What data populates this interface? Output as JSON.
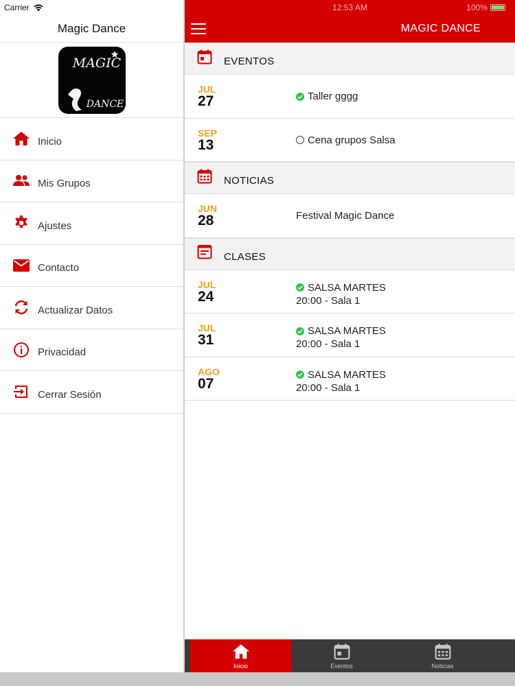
{
  "sidebar": {
    "status": {
      "carrier": "Carrier"
    },
    "title": "Magic Dance",
    "logo": {
      "top_text": "MAGIC",
      "bottom_text": "DANCE"
    },
    "items": [
      {
        "label": "Inicio",
        "icon": "home-icon"
      },
      {
        "label": "Mis Grupos",
        "icon": "groups-icon"
      },
      {
        "label": "Ajustes",
        "icon": "gear-icon"
      },
      {
        "label": "Contacto",
        "icon": "mail-icon"
      },
      {
        "label": "Actualizar Datos",
        "icon": "sync-icon"
      },
      {
        "label": "Privacidad",
        "icon": "info-icon"
      },
      {
        "label": "Cerrar Sesión",
        "icon": "logout-icon"
      }
    ]
  },
  "main": {
    "status": {
      "time": "12:53 AM",
      "battery": "100%"
    },
    "nav_title": "MAGIC DANCE",
    "sections": {
      "eventos": {
        "label": "EVENTOS",
        "rows": [
          {
            "month": "JUL",
            "day": "27",
            "title": "Taller gggg",
            "status": "confirmed"
          },
          {
            "month": "SEP",
            "day": "13",
            "title": "Cena grupos Salsa",
            "status": "pending"
          }
        ]
      },
      "noticias": {
        "label": "NOTICIAS",
        "rows": [
          {
            "month": "JUN",
            "day": "28",
            "title": "Festival Magic Dance"
          }
        ]
      },
      "clases": {
        "label": "CLASES",
        "rows": [
          {
            "month": "JUL",
            "day": "24",
            "title": "SALSA MARTES",
            "detail": "20:00 - Sala 1",
            "status": "confirmed"
          },
          {
            "month": "JUL",
            "day": "31",
            "title": "SALSA MARTES",
            "detail": "20:00 - Sala 1",
            "status": "confirmed"
          },
          {
            "month": "AGO",
            "day": "07",
            "title": "SALSA MARTES",
            "detail": "20:00 - Sala 1",
            "status": "confirmed"
          }
        ]
      }
    }
  },
  "tabbar": {
    "tabs": [
      {
        "label": "Inicio",
        "icon": "home-icon",
        "active": true
      },
      {
        "label": "Eventos",
        "icon": "calendar-icon",
        "active": false
      },
      {
        "label": "Noticias",
        "icon": "calendar-icon",
        "active": false
      }
    ]
  },
  "colors": {
    "brand_red": "#d40000",
    "month_orange": "#f0a020",
    "status_green": "#35c24f",
    "tabbar_dark": "#3a3a3a"
  }
}
